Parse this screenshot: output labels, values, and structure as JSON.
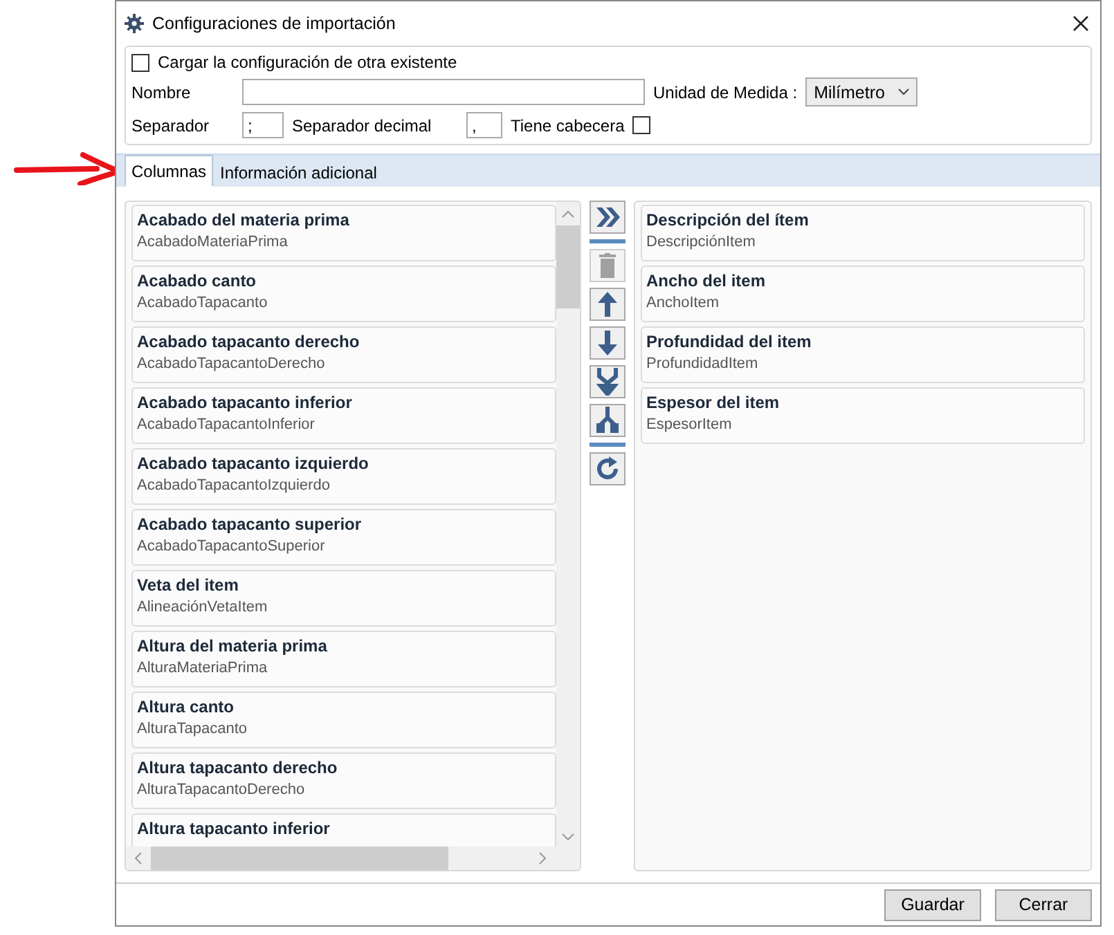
{
  "window": {
    "title": "Configuraciones de importación"
  },
  "options": {
    "load_existing": {
      "label": "Cargar la configuración de otra existente",
      "checked": false
    },
    "name_label": "Nombre",
    "unit_label": "Unidad de Medida :",
    "unit_value": "Milímetro",
    "separator_label": "Separador",
    "separator_value": ";",
    "decimal_label": "Separador decimal",
    "decimal_value": ",",
    "header": {
      "label": "Tiene cabecera",
      "checked": false
    }
  },
  "tabs": [
    {
      "label": "Columnas",
      "selected": true
    },
    {
      "label": "Información adicional",
      "selected": false
    }
  ],
  "available_columns": [
    {
      "title": "Acabado del materia prima",
      "field": "AcabadoMateriaPrima"
    },
    {
      "title": "Acabado canto",
      "field": "AcabadoTapacanto"
    },
    {
      "title": "Acabado tapacanto derecho",
      "field": "AcabadoTapacantoDerecho"
    },
    {
      "title": "Acabado tapacanto inferior",
      "field": "AcabadoTapacantoInferior"
    },
    {
      "title": "Acabado tapacanto izquierdo",
      "field": "AcabadoTapacantoIzquierdo"
    },
    {
      "title": "Acabado tapacanto superior",
      "field": "AcabadoTapacantoSuperior"
    },
    {
      "title": "Veta del item",
      "field": "AlineaciónVetaItem"
    },
    {
      "title": "Altura del materia prima",
      "field": "AlturaMateriaPrima"
    },
    {
      "title": "Altura canto",
      "field": "AlturaTapacanto"
    },
    {
      "title": "Altura tapacanto derecho",
      "field": "AlturaTapacantoDerecho"
    },
    {
      "title": "Altura tapacanto inferior"
    }
  ],
  "toolbar": [
    {
      "kind": "add",
      "disabled": false
    },
    {
      "kind": "separator"
    },
    {
      "kind": "delete",
      "disabled": true
    },
    {
      "kind": "up",
      "disabled": false
    },
    {
      "kind": "down",
      "disabled": false
    },
    {
      "kind": "merge",
      "disabled": false
    },
    {
      "kind": "split",
      "disabled": false
    },
    {
      "kind": "separator"
    },
    {
      "kind": "reset",
      "disabled": false
    }
  ],
  "selected_columns": [
    {
      "title": "Descripción del ítem",
      "field": "DescripciónItem"
    },
    {
      "title": "Ancho del item",
      "field": "AnchoItem"
    },
    {
      "title": "Profundidad del item",
      "field": "ProfundidadItem"
    },
    {
      "title": "Espesor del item",
      "field": "EspesorItem"
    }
  ],
  "buttons": [
    "Guardar",
    "Cerrar"
  ]
}
